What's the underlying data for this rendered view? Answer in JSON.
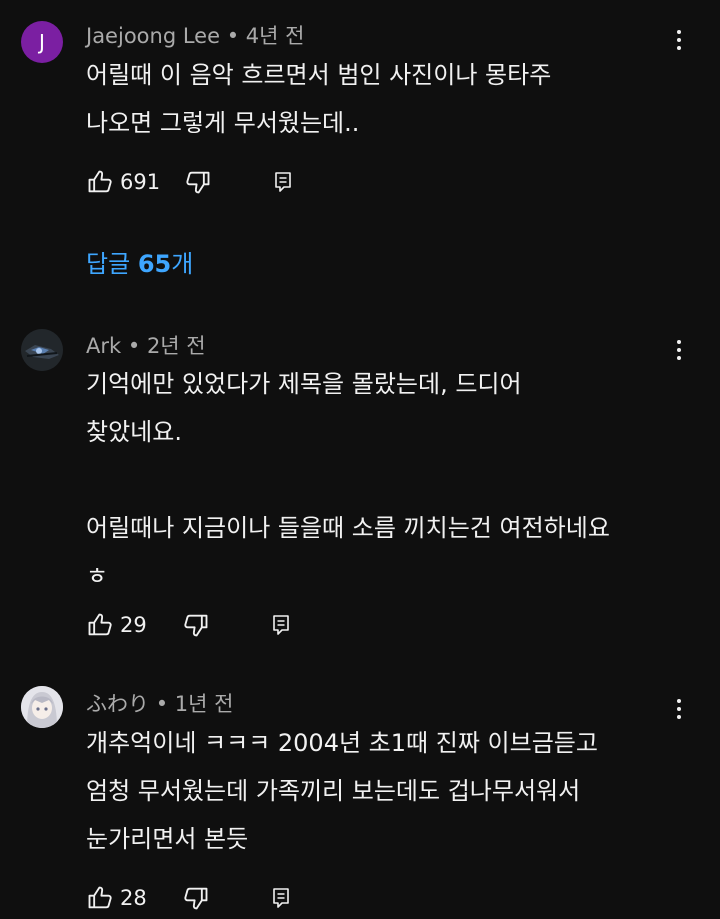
{
  "comments": [
    {
      "author": "Jaejoong Lee",
      "time": "4년 전",
      "avatar_letter": "J",
      "avatar_color": "#7b1fa2",
      "text": "어릴때 이 음악 흐르면서 범인 사진이나 몽타주\n나오면 그렇게 무서웠는데..",
      "likes": "691",
      "replies_prefix": "답글",
      "replies_count": "65",
      "replies_suffix": "개"
    },
    {
      "author": "Ark",
      "time": "2년 전",
      "text": "기억에만 있었다가 제목을 몰랐는데, 드디어\n찾았네요.\n\n어릴때나 지금이나 들을때 소름 끼치는건 여전하네요\nㅎ",
      "likes": "29"
    },
    {
      "author": "ふわり",
      "time": "1년 전",
      "text": "개추억이네 ㅋㅋㅋ 2004년 초1때 진짜 이브금듣고\n엄청 무서웠는데 가족끼리 보는데도 겁나무서워서\n눈가리면서 본듯",
      "likes": "28"
    }
  ],
  "separator": "•",
  "icons": {
    "like": "thumbs-up-icon",
    "dislike": "thumbs-down-icon",
    "reply": "reply-icon",
    "more": "more-vert-icon"
  },
  "accent_color": "#3ea6ff"
}
